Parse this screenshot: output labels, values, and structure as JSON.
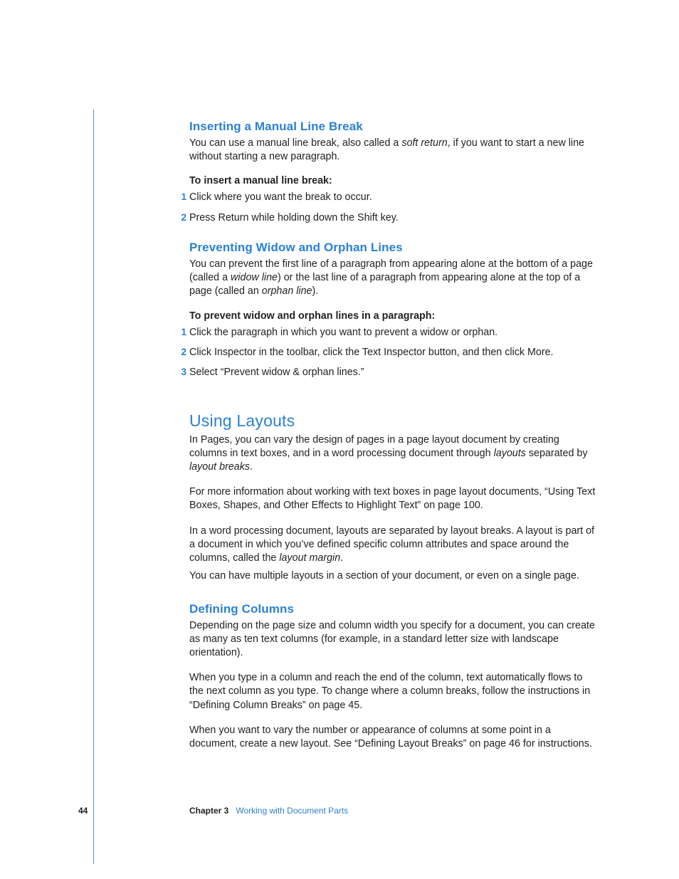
{
  "sec1": {
    "title": "Inserting a Manual Line Break",
    "intro_a": "You can use a manual line break, also called a ",
    "intro_term": "soft return",
    "intro_b": ", if you want to start a new line without starting a new paragraph.",
    "lead": "To insert a manual line break:",
    "steps": [
      "Click where you want the break to occur.",
      "Press Return while holding down the Shift key."
    ]
  },
  "sec2": {
    "title": "Preventing Widow and Orphan Lines",
    "intro_a": "You can prevent the first line of a paragraph from appearing alone at the bottom of a page (called a ",
    "intro_term1": "widow line",
    "intro_b": ") or the last line of a paragraph from appearing alone at the top of a page (called an ",
    "intro_term2": "orphan line",
    "intro_c": ").",
    "lead": "To prevent widow and orphan lines in a paragraph:",
    "steps": [
      "Click the paragraph in which you want to prevent a widow or orphan.",
      "Click Inspector in the toolbar, click the Text Inspector button, and then click More.",
      "Select “Prevent widow & orphan lines.”"
    ]
  },
  "sec3": {
    "title": "Using Layouts",
    "p1_a": "In Pages, you can vary the design of pages in a page layout document by creating columns in text boxes, and in a word processing document through ",
    "p1_term1": "layouts",
    "p1_b": " separated by ",
    "p1_term2": "layout breaks",
    "p1_c": ".",
    "p2": "For more information about working with text boxes in page layout documents, “Using Text Boxes, Shapes, and Other Effects to Highlight Text” on page 100.",
    "p3_a": "In a word processing document, layouts are separated by layout breaks. A layout is part of a document in which you’ve defined specific column attributes and space around the columns, called the ",
    "p3_term": "layout margin",
    "p3_b": ".",
    "p4": "You can have multiple layouts in a section of your document, or even on a single page."
  },
  "sec4": {
    "title": "Defining Columns",
    "p1": "Depending on the page size and column width you specify for a document, you can create as many as ten text columns (for example, in a standard letter size with landscape orientation).",
    "p2": "When you type in a column and reach the end of the column, text automatically flows to the next column as you type. To change where a column breaks, follow the instructions in “Defining Column Breaks” on page 45.",
    "p3": "When you want to vary the number or appearance of columns at some point in a document, create a new layout. See “Defining Layout Breaks” on page 46 for instructions."
  },
  "footer": {
    "page": "44",
    "chapter_label": "Chapter 3",
    "chapter_title": "Working with Document Parts"
  }
}
